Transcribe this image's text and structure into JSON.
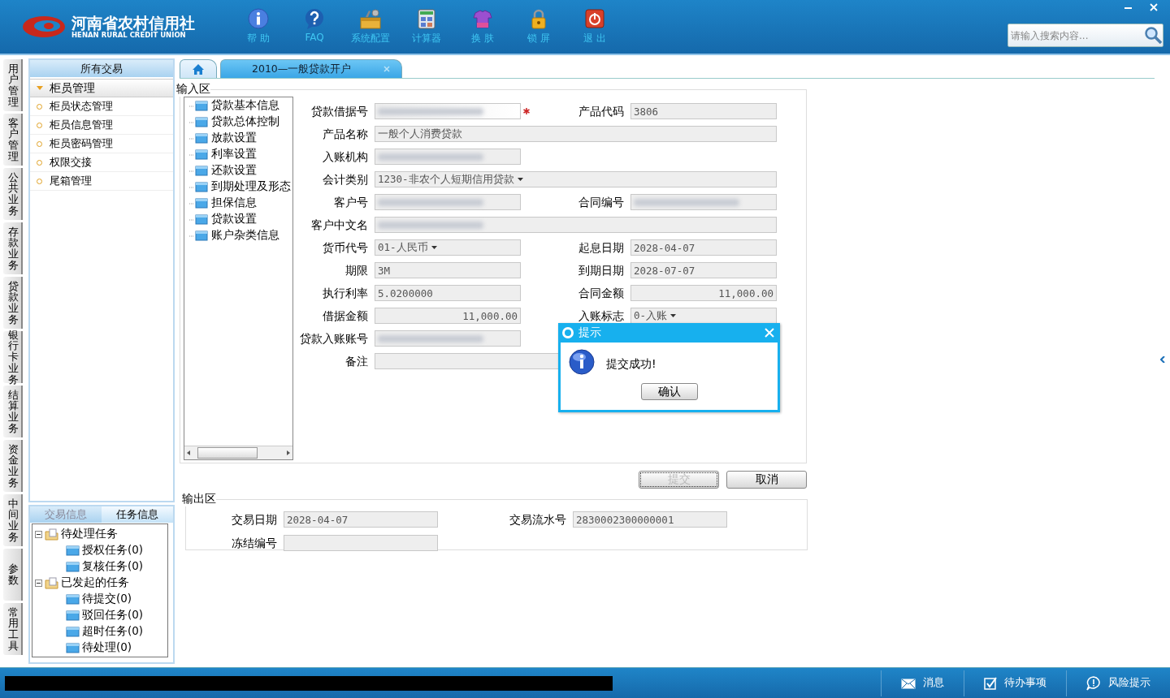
{
  "header": {
    "logo_cn": "河南省农村信用社",
    "logo_en": "HENAN RURAL CREDIT UNION",
    "toolbar": [
      {
        "kind": "help",
        "label": "帮 助"
      },
      {
        "kind": "faq",
        "label": "FAQ"
      },
      {
        "kind": "config",
        "label": "系统配置"
      },
      {
        "kind": "calculator",
        "label": "计算器"
      },
      {
        "kind": "skin",
        "label": "换 肤"
      },
      {
        "kind": "lock",
        "label": "锁 屏"
      },
      {
        "kind": "exit",
        "label": "退 出"
      }
    ],
    "search": {
      "placeholder": "请输入搜索内容..."
    }
  },
  "side_tabs": [
    "用户管理",
    "客户管理",
    "公共业务",
    "存款业务",
    "贷款业务",
    "银行卡业务",
    "结算业务",
    "资金业务",
    "中间业务",
    "参数",
    "常用工具"
  ],
  "nav": {
    "title": "所有交易",
    "group": {
      "label": "柜员管理",
      "expanded": true
    },
    "items": [
      "柜员状态管理",
      "柜员信息管理",
      "柜员密码管理",
      "权限交接",
      "尾箱管理"
    ]
  },
  "task_panel": {
    "tabs": [
      {
        "label": "交易信息",
        "selected": false
      },
      {
        "label": "任务信息",
        "selected": true
      }
    ],
    "tree": [
      {
        "label": "待处理任务",
        "expanded": true,
        "children": [
          {
            "label": "授权任务(0)"
          },
          {
            "label": "复核任务(0)"
          }
        ]
      },
      {
        "label": "已发起的任务",
        "expanded": true,
        "children": [
          {
            "label": "待提交(0)"
          },
          {
            "label": "驳回任务(0)"
          },
          {
            "label": "超时任务(0)"
          },
          {
            "label": "待处理(0)"
          }
        ]
      }
    ]
  },
  "tabs": [
    {
      "kind": "home",
      "selected": false
    },
    {
      "kind": "page",
      "label": "2010—一般贷款开户",
      "selected": true
    }
  ],
  "input_area": {
    "title": "输入区",
    "sections": [
      "贷款基本信息",
      "贷款总体控制",
      "放款设置",
      "利率设置",
      "还款设置",
      "到期处理及形态",
      "担保信息",
      "贷款设置",
      "账户杂类信息"
    ],
    "rows": [
      [
        {
          "label": "贷款借据号",
          "kind": "text",
          "redacted": true,
          "required": true
        },
        {
          "label": "产品代码",
          "kind": "text",
          "value": "3806"
        }
      ],
      [
        {
          "label": "产品名称",
          "kind": "text",
          "value": "一般个人消费贷款",
          "wide": true
        }
      ],
      [
        {
          "label": "入账机构",
          "kind": "text",
          "redacted": true
        }
      ],
      [
        {
          "label": "会计类别",
          "kind": "select",
          "value": "1230-非农个人短期信用贷款",
          "wide": true
        }
      ],
      [
        {
          "label": "客户号",
          "kind": "text",
          "redacted": true
        },
        {
          "label": "合同编号",
          "kind": "text",
          "redacted": true
        }
      ],
      [
        {
          "label": "客户中文名",
          "kind": "text",
          "redacted": true,
          "wide": true
        }
      ],
      [
        {
          "label": "货币代号",
          "kind": "select",
          "value": "01-人民币"
        },
        {
          "label": "起息日期",
          "kind": "text",
          "value": "2028-04-07"
        }
      ],
      [
        {
          "label": "期限",
          "kind": "text",
          "value": "3M"
        },
        {
          "label": "到期日期",
          "kind": "text",
          "value": "2028-07-07"
        }
      ],
      [
        {
          "label": "执行利率",
          "kind": "text",
          "value": "5.0200000"
        },
        {
          "label": "合同金额",
          "kind": "amount",
          "value": "11,000.00"
        }
      ],
      [
        {
          "label": "借据金额",
          "kind": "amount",
          "value": "11,000.00"
        },
        {
          "label": "入账标志",
          "kind": "select",
          "value": "0-入账"
        }
      ],
      [
        {
          "label": "贷款入账账号",
          "kind": "text",
          "redacted": true
        }
      ],
      [
        {
          "label": "备注",
          "kind": "text",
          "wide": true
        }
      ]
    ]
  },
  "buttons": [
    {
      "label": "提交",
      "disabled": true
    },
    {
      "label": "取消",
      "disabled": false
    }
  ],
  "output_area": {
    "title": "输出区",
    "fields": [
      {
        "label": "交易日期",
        "value": "2028-04-07"
      },
      {
        "label": "交易流水号",
        "value": "2830002300000001"
      },
      {
        "label": "冻结编号"
      }
    ]
  },
  "dialog": {
    "title": "提示",
    "message": "提交成功!",
    "button": "确认"
  },
  "status_bar": {
    "items": [
      {
        "kind": "message",
        "label": "消息"
      },
      {
        "kind": "todo",
        "label": "待办事项"
      },
      {
        "kind": "risk",
        "label": "风险提示"
      }
    ]
  }
}
